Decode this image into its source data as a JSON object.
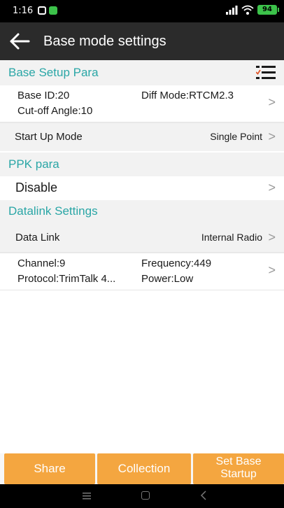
{
  "status_bar": {
    "time": "1:16",
    "battery": "94"
  },
  "toolbar": {
    "title": "Base mode settings"
  },
  "base_setup": {
    "header": "Base Setup Para",
    "base_id": "Base ID:20",
    "diff_mode": "Diff Mode:RTCM2.3",
    "cutoff_angle": "Cut-off Angle:10",
    "start_up_label": "Start Up Mode",
    "start_up_value": "Single Point"
  },
  "ppk": {
    "header": "PPK para",
    "value": "Disable"
  },
  "datalink": {
    "header": "Datalink Settings",
    "label": "Data Link",
    "value": "Internal Radio",
    "channel": "Channel:9",
    "frequency": "Frequency:449",
    "protocol": "Protocol:TrimTalk 4...",
    "power": "Power:Low"
  },
  "buttons": {
    "share": "Share",
    "collection": "Collection",
    "set_base_line1": "Set Base",
    "set_base_line2": "Startup"
  },
  "chevron": ">",
  "colors": {
    "accent": "#2aa6a6",
    "button": "#f4a640",
    "toolbar": "#2b2b2b",
    "section_bg": "#f2f2f2"
  },
  "icons": [
    "back-arrow-icon",
    "list-settings-icon",
    "chevron-right-icon",
    "signal-icon",
    "wifi-icon",
    "battery-icon",
    "nav-menu-icon",
    "nav-home-icon",
    "nav-back-icon"
  ]
}
